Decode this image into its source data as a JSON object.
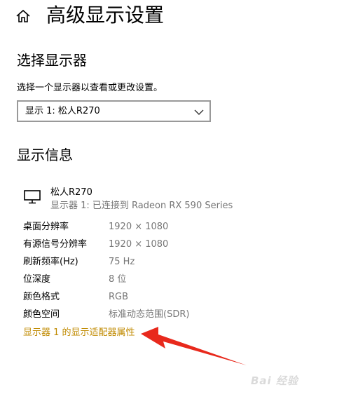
{
  "header": {
    "title": "高级显示设置",
    "home_icon": "home-icon"
  },
  "select_display": {
    "heading": "选择显示器",
    "description": "选择一个显示器以查看或更改设置。",
    "selected": "显示 1: 松人R270"
  },
  "display_info": {
    "heading": "显示信息",
    "monitor_name": "松人R270",
    "monitor_connection": "显示器 1: 已连接到 Radeon RX 590 Series",
    "rows": [
      {
        "label": "桌面分辨率",
        "value": "1920 × 1080"
      },
      {
        "label": "有源信号分辨率",
        "value": "1920 × 1080"
      },
      {
        "label": "刷新频率(Hz)",
        "value": "75 Hz"
      },
      {
        "label": "位深度",
        "value": "8 位"
      },
      {
        "label": "颜色格式",
        "value": "RGB"
      },
      {
        "label": "颜色空间",
        "value": "标准动态范围(SDR)"
      }
    ],
    "adapter_link": "显示器 1 的显示适配器属性"
  },
  "colors": {
    "link": "#c08a00",
    "arrow": "#e8291c",
    "secondary_text": "#767676"
  },
  "watermark": "Bai 经验"
}
